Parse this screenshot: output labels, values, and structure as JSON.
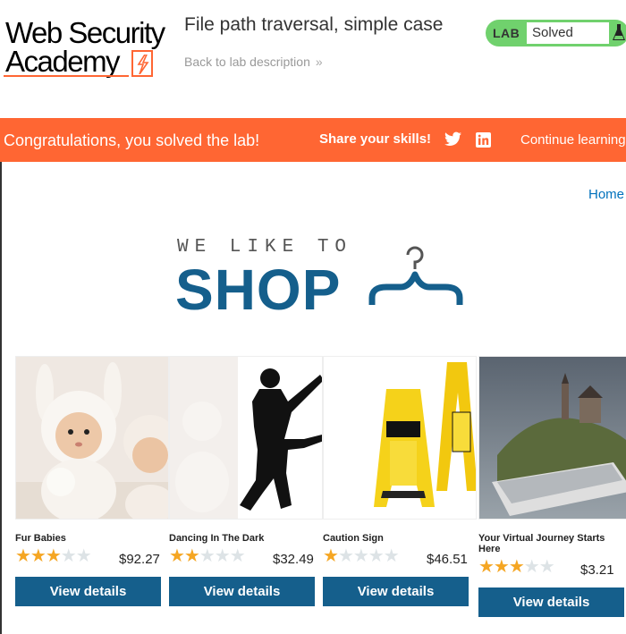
{
  "header": {
    "logo_line1": "Web Security",
    "logo_line2": "Academy",
    "lab_title": "File path traversal, simple case",
    "back_link": "Back to lab description",
    "status_tag": "LAB",
    "status_value": "Solved"
  },
  "banner": {
    "message": "Congratulations, you solved the lab!",
    "share": "Share your skills!",
    "continue": "Continue learning"
  },
  "nav": {
    "home": "Home"
  },
  "hero": {
    "tagline": "WE LIKE TO",
    "title": "SHOP"
  },
  "colors": {
    "accent": "#ff6633",
    "brand": "#155f8c",
    "solved": "#70d16d",
    "star": "#f5a623"
  },
  "products": [
    {
      "name": "Fur Babies",
      "rating": 3,
      "price": "$92.27",
      "button": "View details"
    },
    {
      "name": "Dancing In The Dark",
      "rating": 2,
      "price": "$32.49",
      "button": "View details"
    },
    {
      "name": "Caution Sign",
      "rating": 1,
      "price": "$46.51",
      "button": "View details"
    },
    {
      "name": "Your Virtual Journey Starts Here",
      "rating": 3,
      "price": "$3.21",
      "button": "View details"
    }
  ]
}
